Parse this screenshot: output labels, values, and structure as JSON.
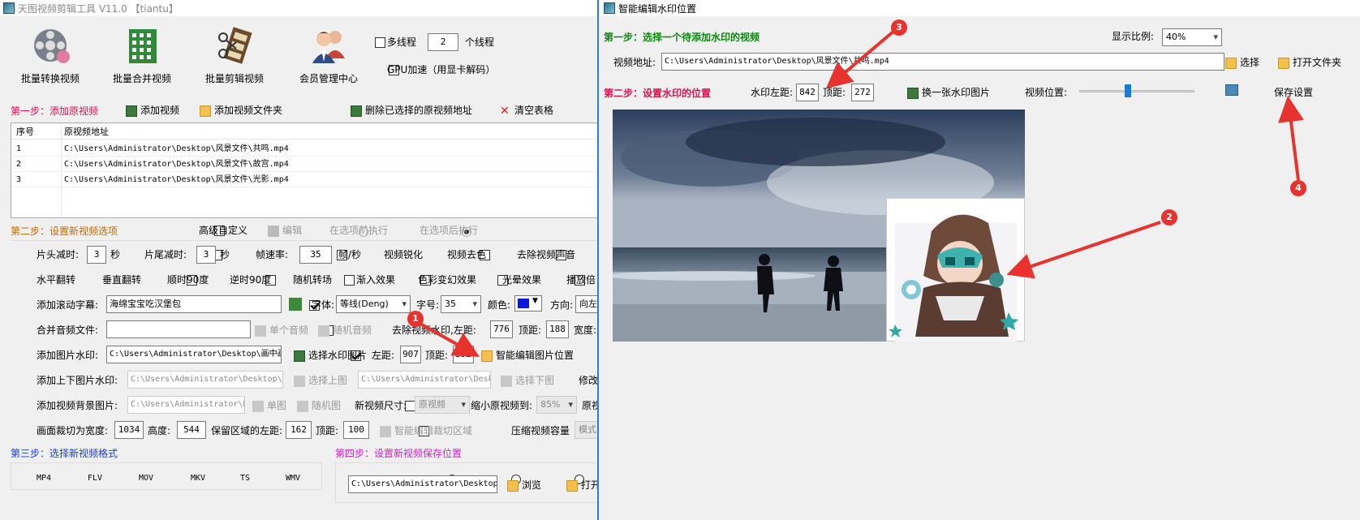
{
  "left": {
    "title": "天图视频剪辑工具 V11.0 【tiantu】",
    "toolbar": [
      {
        "label": "批量转换视频",
        "icon": "film-reel-icon"
      },
      {
        "label": "批量合并视频",
        "icon": "merge-grid-icon"
      },
      {
        "label": "批量剪辑视频",
        "icon": "film-scissors-icon"
      },
      {
        "label": "会员管理中心",
        "icon": "users-icon"
      }
    ],
    "multithread_label": "多线程",
    "thread_count": "2",
    "thread_unit": "个线程",
    "gpu_label": "GPU加速（用显卡解码）",
    "step1": {
      "label": "第一步：添加原视频",
      "add_video": "添加视频",
      "add_folder": "添加视频文件夹",
      "delete_selected": "删除已选择的原视频地址",
      "clear_table": "清空表格"
    },
    "table": {
      "headers": [
        "序号",
        "原视频地址"
      ],
      "rows": [
        [
          "1",
          "C:\\Users\\Administrator\\Desktop\\风景文件\\共鸣.mp4"
        ],
        [
          "2",
          "C:\\Users\\Administrator\\Desktop\\风景文件\\故宫.mp4"
        ],
        [
          "3",
          "C:\\Users\\Administrator\\Desktop\\风景文件\\光影.mp4"
        ]
      ]
    },
    "step2": {
      "label": "第二步：设置新视频选项",
      "advanced": "高级自定义",
      "edit": "编辑",
      "before": "在选项前执行",
      "after": "在选项后执行"
    },
    "row1": {
      "head_cut": "片头减时:",
      "head_val": "3",
      "sec1": "秒",
      "tail_cut": "片尾减时:",
      "tail_val": "3",
      "sec2": "秒",
      "fps": "帧速率:",
      "fps_val": "35",
      "fps_unit": "帧/秒",
      "sharpen": "视频锐化",
      "decolor": "视频去色",
      "remove_audio": "去除视频声音"
    },
    "row2": [
      "水平翻转",
      "垂直翻转",
      "顺时90度",
      "逆时90度",
      "随机转场",
      "渐入效果",
      "色彩变幻效果",
      "光晕效果",
      "播放倍"
    ],
    "row3": {
      "scroll_sub": "添加滚动字幕:",
      "sub_text": "海绵宝宝吃汉堡包",
      "font_label": "字体:",
      "font_val": "等线(Deng)",
      "size_label": "字号:",
      "size_val": "35",
      "color_label": "颜色:",
      "dir_label": "方向:",
      "dir_val": "向左"
    },
    "row4": {
      "merge_audio": "合并音频文件:",
      "single_audio": "单个音频",
      "random_audio": "随机音频",
      "remove_wm": "去除视频水印,左距:",
      "left_val": "776",
      "top_label": "顶距:",
      "top_val": "188",
      "width_label": "宽度:"
    },
    "row5": {
      "img_wm": "添加图片水印:",
      "img_path": "C:\\Users\\Administrator\\Desktop\\画中画",
      "choose_img": "选择水印图片",
      "left_label": "左距:",
      "left_val": "907",
      "top_label": "顶距:",
      "top_val": "392",
      "smart_edit": "智能编辑图片位置"
    },
    "row6": {
      "topbottom": "添加上下图片水印:",
      "path1": "C:\\Users\\Administrator\\Desktop\\画",
      "choose_top": "选择上图",
      "path2": "C:\\Users\\Administrator\\Desk",
      "choose_bottom": "选择下图",
      "modify": "修改"
    },
    "row7": {
      "bg_img": "添加视频背景图片:",
      "path": "C:\\Users\\Administrator\\D",
      "single": "单图",
      "random": "随机图",
      "new_size": "新视频尺寸:",
      "size_val": "原视频",
      "shrink": "缩小原视频到:",
      "shrink_val": "85%",
      "orig": "原视"
    },
    "row8": {
      "crop": "画面裁切为宽度:",
      "w_val": "1034",
      "h_label": "高度:",
      "h_val": "544",
      "keep_left": "保留区域的左距:",
      "left_val": "162",
      "top_label": "顶距:",
      "top_val": "100",
      "smart_crop": "智能编辑裁切区域",
      "compress": "压缩视频容量",
      "mode": "模式"
    },
    "step3": {
      "label": "第三步：选择新视频格式",
      "formats": [
        "MP4",
        "FLV",
        "MOV",
        "MKV",
        "TS",
        "WMV"
      ]
    },
    "step4": {
      "label": "第四步：设置新视频保存位置",
      "path": "C:\\Users\\Administrator\\Desktop",
      "browse": "浏览",
      "open": "打开"
    }
  },
  "right": {
    "title": "智能编辑水印位置",
    "step1": "第一步：选择一个待添加水印的视频",
    "ratio_label": "显示比例:",
    "ratio_val": "40%",
    "addr_label": "视频地址:",
    "addr_val": "C:\\Users\\Administrator\\Desktop\\风景文件\\共鸣.mp4",
    "choose": "选择",
    "open_folder": "打开文件夹",
    "step2": "第二步：设置水印的位置",
    "wm_left_label": "水印左距:",
    "wm_left_val": "842",
    "wm_top_label": "顶距:",
    "wm_top_val": "272",
    "swap_img": "换一张水印图片",
    "video_pos": "视频位置:",
    "slider_level": 0.42,
    "save": "保存设置"
  },
  "markers": [
    "1",
    "2",
    "3",
    "4"
  ],
  "colors": {
    "step_red": "#e0124f",
    "step_green": "#0a8a0a",
    "step_blue": "#1a3fd6",
    "step_magenta": "#d020d0",
    "marker": "#e8322e"
  }
}
